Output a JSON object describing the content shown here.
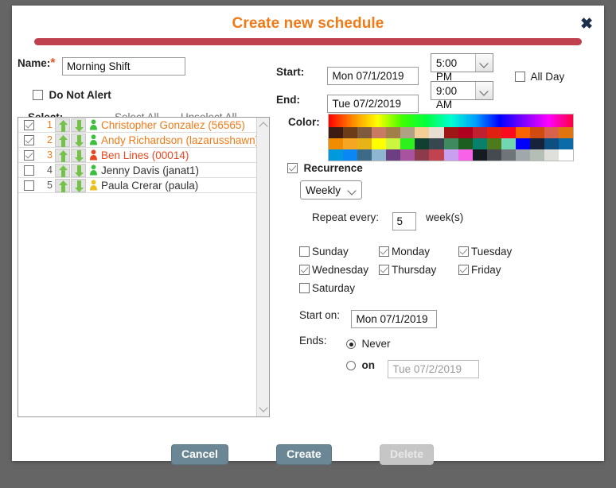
{
  "dialog": {
    "title": "Create new schedule",
    "close_icon": "close-icon"
  },
  "form": {
    "name_label": "Name:",
    "name_required_mark": "*",
    "name_value": "Morning Shift",
    "do_not_alert_label": "Do Not Alert",
    "do_not_alert_checked": false,
    "select_label": "Select:",
    "select_all_label": "Select All",
    "unselect_all_label": "Unselect All",
    "start_label": "Start:",
    "start_date": "Mon 07/1/2019",
    "start_time": "5:00 PM",
    "end_label": "End:",
    "end_date": "Tue 07/2/2019",
    "end_time": "9:00 AM",
    "all_day_label": "All Day",
    "all_day_checked": false,
    "color_label": "Color:"
  },
  "people": [
    {
      "num": "1",
      "checked": true,
      "name": "Christopher Gonzalez (56565)",
      "icon": "person-icon",
      "icon_color": "#3fbf3f",
      "selected": true,
      "red": false
    },
    {
      "num": "2",
      "checked": true,
      "name": "Andy Richardson (lazarusshawn)",
      "icon": "person-icon",
      "icon_color": "#3fbf3f",
      "selected": true,
      "red": false
    },
    {
      "num": "3",
      "checked": true,
      "name": "Ben Lines (00014)",
      "icon": "person-icon",
      "icon_color": "#e8471f",
      "selected": true,
      "red": true
    },
    {
      "num": "4",
      "checked": false,
      "name": "Jenny Davis (janat1)",
      "icon": "person-icon",
      "icon_color": "#3fbf3f",
      "selected": false,
      "red": false
    },
    {
      "num": "5",
      "checked": false,
      "name": "Paula Crerar (paula)",
      "icon": "person-icon",
      "icon_color": "#e8c020",
      "selected": false,
      "red": false
    }
  ],
  "recurrence": {
    "label": "Recurrence",
    "checked": true,
    "frequency": "Weekly",
    "repeat_every_label": "Repeat every:",
    "repeat_every_value": "5",
    "repeat_unit_label": "week(s)",
    "days": [
      {
        "label": "Sunday",
        "checked": false
      },
      {
        "label": "Monday",
        "checked": true
      },
      {
        "label": "Tuesday",
        "checked": true
      },
      {
        "label": "Wednesday",
        "checked": true
      },
      {
        "label": "Thursday",
        "checked": true
      },
      {
        "label": "Friday",
        "checked": true
      },
      {
        "label": "Saturday",
        "checked": false
      }
    ],
    "start_on_label": "Start on:",
    "start_on_value": "Mon 07/1/2019",
    "ends_label": "Ends:",
    "ends_never_label": "Never",
    "ends_never_selected": true,
    "ends_on_label": "on",
    "ends_on_selected": false,
    "ends_on_value": "Tue 07/2/2019"
  },
  "footer": {
    "cancel_label": "Cancel",
    "create_label": "Create",
    "delete_label": "Delete",
    "delete_disabled": true
  },
  "colors": {
    "title": "#ef7b18",
    "rule": "#bf4150",
    "accent_button": "#6b8795",
    "backdrop": "#656565"
  },
  "palette": {
    "gradient": "linear-gradient(to right,#ff0000,#ff8c00,#ffff00,#40ff00,#00ff40,#00ffd0,#00a0ff,#0000ff,#8000ff,#ff00ff,#ff0040)",
    "rows": [
      [
        "#3d1c14",
        "#6b3c17",
        "#7e5b3f",
        "#c97a63",
        "#a08048",
        "#b0a084",
        "#f2cd96",
        "#e6ded3",
        "#9e1616",
        "#b00020",
        "#c02030",
        "#e02010",
        "#fa0a1e",
        "#fa6400",
        "#d14a10",
        "#d9624a",
        "#e07510"
      ],
      [
        "#ef8c00",
        "#f5a623",
        "#e8b317",
        "#ffff00",
        "#ccf542",
        "#2bf21f",
        "#10402f",
        "#37474f",
        "#3f8a5e",
        "#1b5e20",
        "#08806a",
        "#4e7a1e",
        "#72d6b0",
        "#0000ff",
        "#17223b",
        "#0d4f80",
        "#0b6aa8"
      ],
      [
        "#0099dd",
        "#0a86f5",
        "#3d6a86",
        "#8fb6d0",
        "#6b3f82",
        "#a7539e",
        "#8b3b4c",
        "#c0434f",
        "#c9a0f0",
        "#f862e8",
        "#161b22",
        "#444a4f",
        "#6f7478",
        "#a0a8ac",
        "#b4bdb6",
        "#e0e0da",
        "#ffffff"
      ]
    ]
  }
}
